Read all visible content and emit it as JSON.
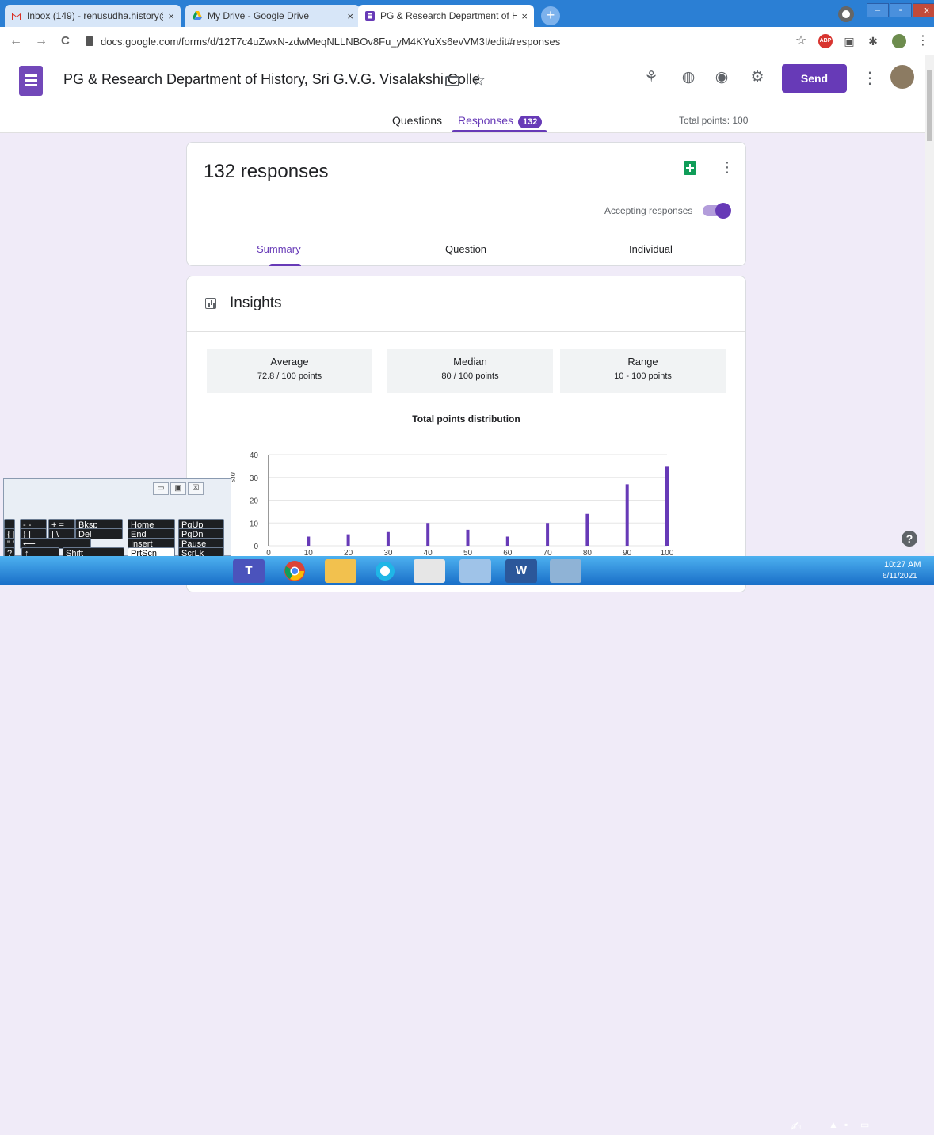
{
  "browser": {
    "tabs": [
      {
        "label": "Inbox (149) - renusudha.history@",
        "favicon": "gmail-icon",
        "close": "×"
      },
      {
        "label": "My Drive - Google Drive",
        "favicon": "drive-icon",
        "close": "×"
      },
      {
        "label": "PG & Research Department of H",
        "favicon": "forms-icon",
        "close": "×"
      }
    ],
    "new_tab": "+",
    "url": "docs.google.com/forms/d/12T7c4uZwxN-zdwMeqNLLNBOv8Fu_yM4KYuXs6evVM3I/edit#responses",
    "nav": {
      "back": "←",
      "forward": "→",
      "reload": "C"
    },
    "toolbar_icons": {
      "star": "☆",
      "abp": "ABP",
      "ext1": "▣",
      "puzzle": "✱",
      "menu": "⋮"
    }
  },
  "form": {
    "title": "PG & Research Department of History, Sri G.V.G. Visalakshi Colle",
    "send_label": "Send",
    "more": "⋮",
    "tabs": {
      "questions": "Questions",
      "responses": "Responses",
      "responses_count": "132"
    },
    "total_points": "Total points: 100",
    "accent": "#673ab7"
  },
  "summary": {
    "response_count": "132 responses",
    "more": "⋮",
    "accepting_label": "Accepting responses",
    "accepting": true,
    "subtabs": {
      "summary": "Summary",
      "question": "Question",
      "individual": "Individual"
    }
  },
  "insights": {
    "title": "Insights",
    "stats": {
      "average": {
        "label": "Average",
        "value": "72.8 / 100 points"
      },
      "median": {
        "label": "Median",
        "value": "80 / 100 points"
      },
      "range": {
        "label": "Range",
        "value": "10 - 100 points"
      }
    },
    "chart_title": "Total points distribution"
  },
  "chart_data": {
    "type": "bar",
    "title": "Total points distribution",
    "x": [
      10,
      20,
      30,
      40,
      50,
      60,
      70,
      80,
      90,
      100
    ],
    "values": [
      4,
      5,
      6,
      10,
      7,
      4,
      10,
      14,
      27,
      35
    ],
    "xlim": [
      0,
      100
    ],
    "ylim": [
      0,
      40
    ],
    "yticks": [
      0,
      10,
      20,
      30,
      40
    ],
    "xticks": [
      0,
      10,
      20,
      30,
      40,
      50,
      60,
      70,
      80,
      90,
      100
    ],
    "ylabel": "nts",
    "bar_color": "#673ab7",
    "grid": true
  },
  "keyboard": {
    "window_buttons": [
      "▭",
      "▣",
      "☒"
    ],
    "keys": [
      {
        "label": "",
        "row": 0,
        "col": 0
      },
      {
        "label": "- -",
        "row": 0,
        "col": 1
      },
      {
        "label": "+ =",
        "row": 0,
        "col": 2
      },
      {
        "label": "Bksp",
        "row": 0,
        "col": 3
      },
      {
        "label": "Home",
        "row": 0,
        "col": 4
      },
      {
        "label": "PgUp",
        "row": 0,
        "col": 5
      },
      {
        "label": "{ [",
        "row": 1,
        "col": 0
      },
      {
        "label": "} ]",
        "row": 1,
        "col": 1
      },
      {
        "label": "| \\",
        "row": 1,
        "col": 2
      },
      {
        "label": "Del",
        "row": 1,
        "col": 3
      },
      {
        "label": "End",
        "row": 1,
        "col": 4
      },
      {
        "label": "PgDn",
        "row": 1,
        "col": 5
      },
      {
        "label": "\" '",
        "row": 2,
        "col": 0
      },
      {
        "label": "⟵",
        "row": 2,
        "col": 1
      },
      {
        "label": "Insert",
        "row": 2,
        "col": 4
      },
      {
        "label": "Pause",
        "row": 2,
        "col": 5
      },
      {
        "label": "? /",
        "row": 3,
        "col": 0
      },
      {
        "label": "↑",
        "row": 3,
        "col": 1
      },
      {
        "label": "Shift",
        "row": 3,
        "col": 2
      },
      {
        "label": "PrtScn",
        "row": 3,
        "col": 4
      },
      {
        "label": "ScrLk",
        "row": 3,
        "col": 5
      }
    ]
  },
  "help": "?",
  "taskbar": {
    "apps": [
      "teams-icon",
      "chrome-icon",
      "file-explorer-icon",
      "browser-icon",
      "presentation-icon",
      "control-panel-icon",
      "word-icon",
      "keyboard-icon"
    ],
    "time": "10:27 AM",
    "date": "6/11/2021"
  }
}
